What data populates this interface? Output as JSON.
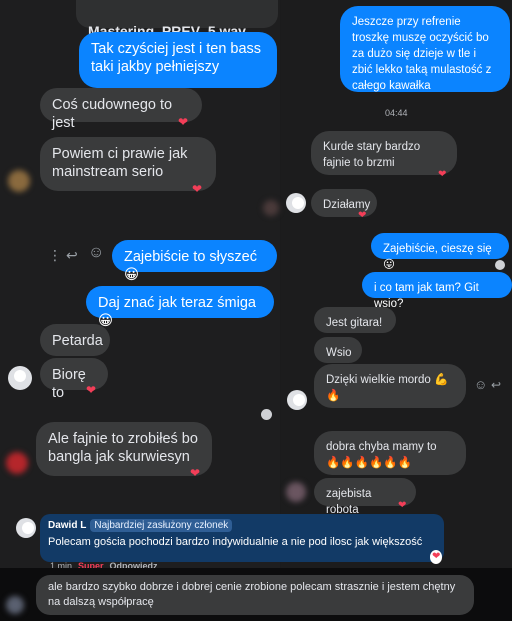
{
  "left_chat": {
    "file_name": "Mastering_PREV_5.wav",
    "messages": [
      {
        "text": "Tak czyściej jest i ten bass taki jakby pełniejszy"
      },
      {
        "text": "Coś cudownego to jest"
      },
      {
        "text": "Powiem ci prawie jak mainstream serio"
      },
      {
        "text": "Zajebiście to słyszeć 😀"
      },
      {
        "text": "Daj znać jak teraz śmiga 😀"
      },
      {
        "text": "Petarda"
      },
      {
        "text": "Biorę to"
      },
      {
        "text": "Ale fajnie to zrobiłeś bo bangla jak skurwiesyn"
      }
    ]
  },
  "right_chat": {
    "timestamp": "04:44",
    "messages": [
      {
        "text": "Jeszcze przy refrenie troszkę muszę oczyścić bo za dużo się dzieje w tle i zbić lekko taką mulastość z całego kawałka"
      },
      {
        "text": "Kurde stary bardzo fajnie to brzmi"
      },
      {
        "text": "Działamy"
      },
      {
        "text": "Zajebiście, cieszę się 😛"
      },
      {
        "text": "i co tam jak tam? Git wsio?"
      },
      {
        "text": "Jest gitara!"
      },
      {
        "text": "Wsio"
      },
      {
        "text": "Dzięki wielkie mordo 💪 🔥"
      },
      {
        "text": "dobra chyba mamy to 🔥🔥🔥🔥🔥🔥"
      },
      {
        "text": "zajebista robota"
      }
    ]
  },
  "comment": {
    "author": "Dawid L",
    "badge": "Najbardziej zasłużony członek",
    "text": "Polecam gościa pochodzi bardzo indywidualnie a nie pod ilosc jak większość",
    "time": "1 min",
    "reaction": "Super",
    "reply_label": "Odpowiedz",
    "reply_text": "ale bardzo szybko dobrze i dobrej cenie zrobione polecam strasznie i jestem chętny na dalszą współpracę"
  },
  "icons": {
    "heart": "❤",
    "reply": "↩",
    "smile": "☺",
    "more": "⋮"
  },
  "colors": {
    "incoming_bubble": "#3a3b3c",
    "outgoing_bubble": "#0b84ff",
    "reaction_heart": "#f33e58",
    "comment_bg": "#123a66"
  }
}
